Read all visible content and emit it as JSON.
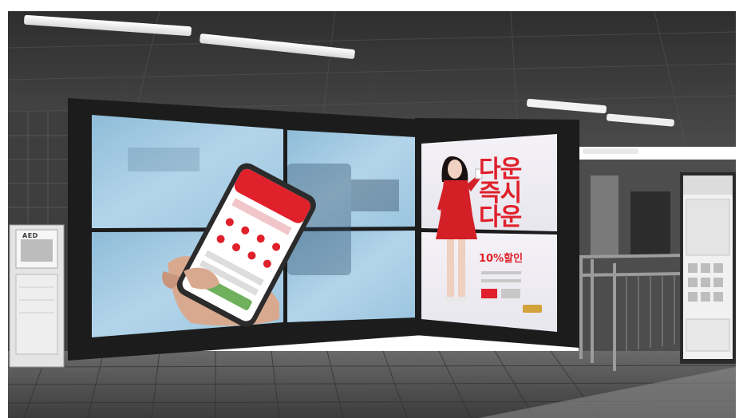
{
  "ad_panel": {
    "headline_line1": "다운",
    "headline_line2": "즉시",
    "headline_line3": "다운",
    "discount": "10%할인"
  },
  "aed": {
    "label": "AED"
  },
  "colors": {
    "brand_red": "#e0202a",
    "ceiling": "#3a3a3a",
    "floor": "#5a5a5a",
    "screen_blue": "#a9cde4"
  }
}
